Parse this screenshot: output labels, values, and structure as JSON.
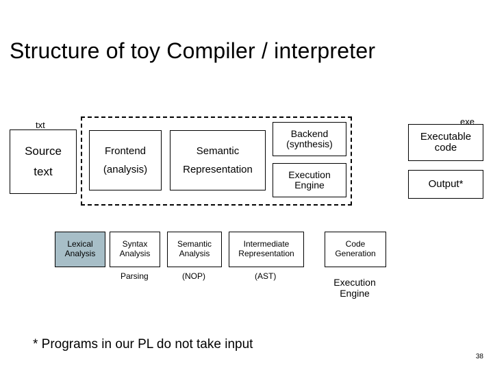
{
  "slide": {
    "title": "Structure of toy Compiler / interpreter",
    "page_number": "38",
    "footnote": "* Programs in our PL do not take input"
  },
  "labels": {
    "txt": "txt",
    "exe": "exe"
  },
  "big": {
    "source_top": "Source",
    "source_bottom": "text",
    "frontend": "Frontend",
    "analysis": "(analysis)",
    "semantic": "Semantic",
    "representation": "Representation",
    "backend_top": "Backend",
    "backend_bottom": "(synthesis)",
    "exec_engine_top": "Execution",
    "exec_engine_bottom": "Engine",
    "executable_top": "Executable",
    "executable_bottom": "code",
    "output": "Output*"
  },
  "stages": {
    "lexical": "Lexical\nAnalysis",
    "syntax": "Syntax\nAnalysis",
    "parsing": "Parsing",
    "semantic": "Semantic\nAnalysis",
    "nop": "(NOP)",
    "intermediate": "Intermediate\nRepresentation",
    "ast": "(AST)",
    "codegen": "Code\nGeneration"
  },
  "exec_small": {
    "top": "Execution",
    "bottom": "Engine"
  },
  "chart_data": {
    "type": "diagram",
    "description": "Block diagram of a toy compiler/interpreter pipeline",
    "nodes": [
      {
        "id": "source",
        "label": "Source text",
        "tag": "txt"
      },
      {
        "id": "frontend",
        "label": "Frontend (analysis)"
      },
      {
        "id": "semantic_rep",
        "label": "Semantic Representation"
      },
      {
        "id": "backend",
        "label": "Backend (synthesis)"
      },
      {
        "id": "exec_engine",
        "label": "Execution Engine"
      },
      {
        "id": "executable",
        "label": "Executable code",
        "tag": "exe"
      },
      {
        "id": "output",
        "label": "Output*"
      },
      {
        "id": "lexical",
        "label": "Lexical Analysis"
      },
      {
        "id": "syntax",
        "label": "Syntax Analysis",
        "sub": "Parsing"
      },
      {
        "id": "semantic_analysis",
        "label": "Semantic Analysis",
        "sub": "(NOP)"
      },
      {
        "id": "ir",
        "label": "Intermediate Representation",
        "sub": "(AST)"
      },
      {
        "id": "codegen",
        "label": "Code Generation"
      },
      {
        "id": "exec_small",
        "label": "Execution Engine"
      }
    ],
    "annotations": [
      "* Programs in our PL do not take input"
    ]
  }
}
